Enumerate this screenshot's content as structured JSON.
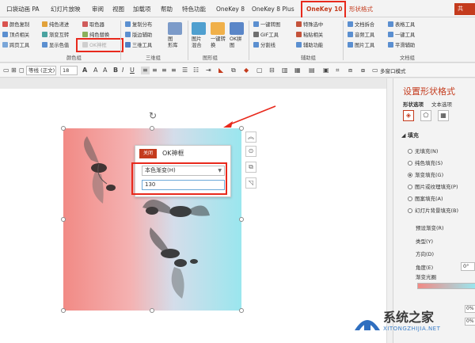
{
  "tabs": [
    "口袋动画 PA",
    "幻灯片放映",
    "审阅",
    "视图",
    "加载项",
    "帮助",
    "特色功能",
    "OneKey 8",
    "OneKey 8 Plus",
    "OneKey 10",
    "形状格式"
  ],
  "share_label": "共",
  "ribbon": {
    "col1": [
      "颜色复制",
      "顶点相关",
      "跨页工具"
    ],
    "col2": [
      "纯色递进",
      "渐变互转",
      "显示色值"
    ],
    "col3": [
      "取色器",
      "纯色替换",
      "OK神框"
    ],
    "col4": [
      "复制分布",
      "版边辅助",
      "三维工具"
    ],
    "big1": "图\n形库",
    "big2": "图片\n混合",
    "big3": "一键转\n换",
    "big4": "OK拼\n图",
    "col5": [
      "一键转图",
      "GIF工具",
      "分割线"
    ],
    "col6": [
      "特殊选中",
      "粘贴相关",
      "辅助功能"
    ],
    "col7": [
      "文档拆合",
      "音频工具",
      "图片工具"
    ],
    "col8": [
      "表格工具",
      "一键工具",
      "平滑辅助"
    ],
    "groups": [
      "颜色组",
      "三维组",
      "图形组",
      "辅助组",
      "文档组"
    ]
  },
  "format_bar": {
    "font": "等线 (正文)",
    "size": "18",
    "mode": "多窗口模式"
  },
  "dialog": {
    "close": "关闭",
    "title": "OK神框",
    "select_value": "本色渐变(H)",
    "input_value": "130"
  },
  "pane": {
    "title": "设置形状格式",
    "tab_shape": "形状选项",
    "tab_text": "文本选项",
    "fill_header": "填充",
    "radios": [
      "无填充(N)",
      "纯色填充(S)",
      "渐变填充(G)",
      "图片或纹理填充(P)",
      "图案填充(A)",
      "幻灯片背景填充(B)"
    ],
    "fields": [
      "预设渐变(R)",
      "类型(Y)",
      "方向(D)",
      "角度(E)",
      "渐变光圈"
    ],
    "angle_value": "0°",
    "small_values": [
      "0%",
      "0%"
    ]
  },
  "watermark": {
    "title": "系统之家",
    "url": "XITONGZHIJIA.NET"
  },
  "colors": {
    "accent": "#c43b1d",
    "highlight": "#e8291c",
    "gradient_left": "#f28a85",
    "gradient_right": "#9ae6ee"
  }
}
